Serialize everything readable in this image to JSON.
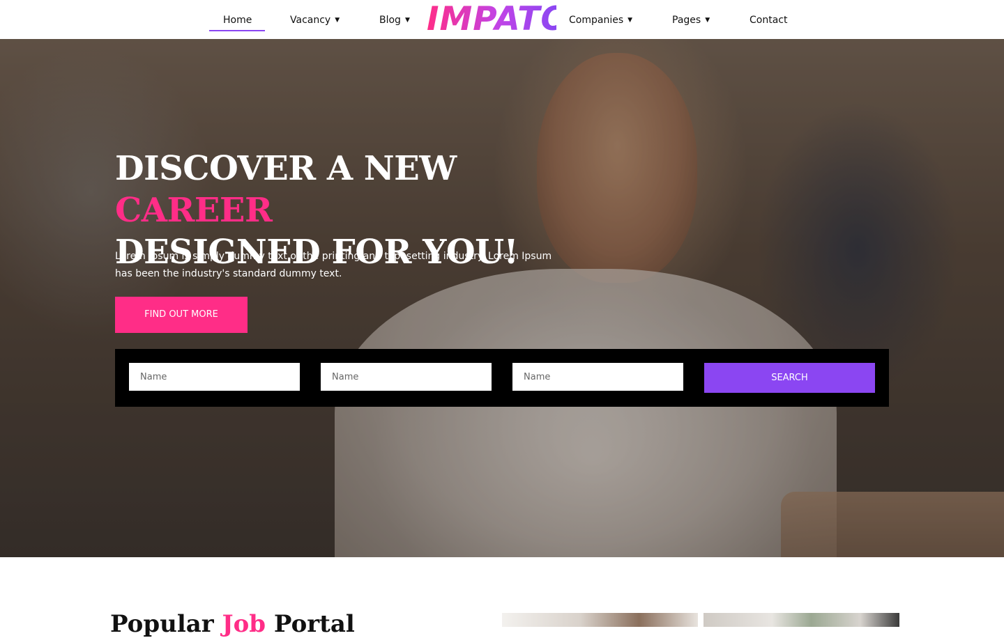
{
  "nav": {
    "items": [
      {
        "label": "Home",
        "active": true,
        "dropdown": false
      },
      {
        "label": "Vacancy",
        "active": false,
        "dropdown": true
      },
      {
        "label": "Blog",
        "active": false,
        "dropdown": true
      },
      {
        "label": "Companies",
        "active": false,
        "dropdown": true
      },
      {
        "label": "Pages",
        "active": false,
        "dropdown": true
      },
      {
        "label": "Contact",
        "active": false,
        "dropdown": false
      }
    ],
    "logo": "IMPATO",
    "chevron_icon": "chevron-down-icon"
  },
  "hero": {
    "title_part1": "DISCOVER A NEW ",
    "title_accent": "CAREER",
    "title_part2": "DESIGNED FOR YOU!",
    "description": "Lorem Ipsum is simply dummy text of the printing and typesetting industry. Lorem Ipsum has been the industry's standard dummy text.",
    "cta_label": "FIND OUT MORE"
  },
  "search": {
    "fields": [
      {
        "placeholder": "Name"
      },
      {
        "placeholder": "Name"
      },
      {
        "placeholder": "Name"
      }
    ],
    "button_label": "SEARCH"
  },
  "section": {
    "title_part1": "Popular ",
    "title_accent": "Job",
    "title_part2": " Portal"
  },
  "colors": {
    "accent_pink": "#ff2d87",
    "accent_purple": "#8b46f2",
    "search_bar_bg": "#000000"
  }
}
